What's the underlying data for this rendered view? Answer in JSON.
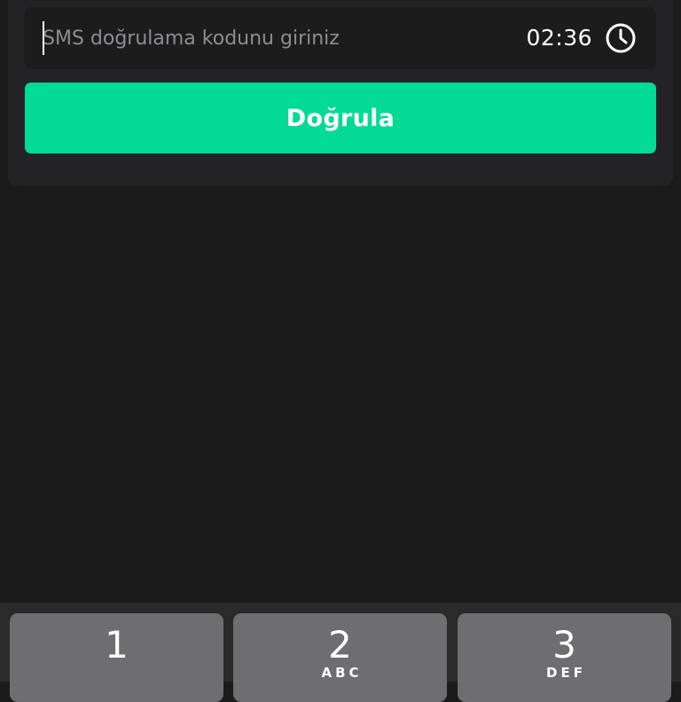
{
  "verification": {
    "code_placeholder": "SMS doğrulama kodunu giriniz",
    "code_value": "",
    "timer": "02:36",
    "verify_label": "Doğrula"
  },
  "keyboard": {
    "keys": [
      {
        "digit": "1",
        "letters": ""
      },
      {
        "digit": "2",
        "letters": "ABC"
      },
      {
        "digit": "3",
        "letters": "DEF"
      }
    ]
  },
  "colors": {
    "background": "#1b1b1c",
    "card": "#232326",
    "accent": "#03da94",
    "key": "#6e6e70"
  },
  "icons": {
    "timer": "clock-icon"
  }
}
